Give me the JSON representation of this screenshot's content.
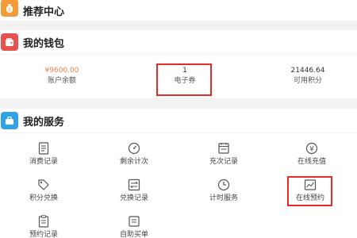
{
  "sections": {
    "recommend": {
      "title": "推荐中心"
    },
    "wallet": {
      "title": "我的钱包"
    },
    "services": {
      "title": "我的服务"
    }
  },
  "wallet": {
    "balance": {
      "value": "¥9600.00",
      "label": "账户余额"
    },
    "coupon": {
      "value": "1",
      "label": "电子券"
    },
    "points": {
      "value": "21446.64",
      "label": "可用积分"
    }
  },
  "services": {
    "items": [
      {
        "label": "消费记录",
        "icon": "receipt-icon"
      },
      {
        "label": "剩余计次",
        "icon": "gauge-icon"
      },
      {
        "label": "充次记录",
        "icon": "calendar-list-icon"
      },
      {
        "label": "在线充值",
        "icon": "yen-coin-icon"
      },
      {
        "label": "积分兑换",
        "icon": "tag-icon"
      },
      {
        "label": "兑换记录",
        "icon": "exchange-icon"
      },
      {
        "label": "计时服务",
        "icon": "clock-icon"
      },
      {
        "label": "在线预约",
        "icon": "trend-chart-icon"
      },
      {
        "label": "预约记录",
        "icon": "clipboard-icon"
      },
      {
        "label": "自助买单",
        "icon": "self-checkout-icon"
      }
    ]
  },
  "colors": {
    "recommend_icon": "#f29b38",
    "wallet_icon": "#e9534f",
    "services_icon": "#2fa3e6",
    "balance_value": "#f0814c",
    "highlight_box": "#e52a2a"
  }
}
